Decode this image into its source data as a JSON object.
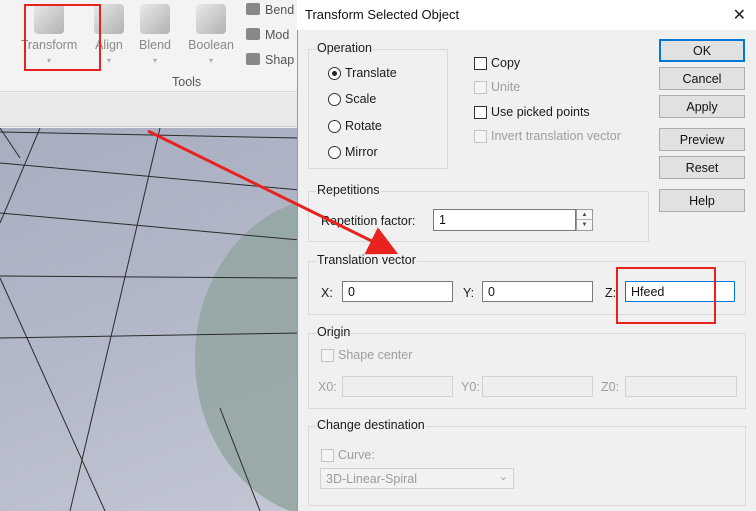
{
  "ribbon": {
    "tools": [
      {
        "label": "Transform",
        "icon": "transform-icon"
      },
      {
        "label": "Align",
        "icon": "align-icon"
      },
      {
        "label": "Blend",
        "icon": "blend-icon"
      },
      {
        "label": "Boolean",
        "icon": "boolean-icon"
      }
    ],
    "side_tools": [
      "Bend",
      "Mod",
      "Shap"
    ],
    "group_label": "Tools"
  },
  "dialog": {
    "title": "Transform Selected Object",
    "close_glyph": "✕",
    "operation": {
      "title": "Operation",
      "options": [
        "Translate",
        "Scale",
        "Rotate",
        "Mirror"
      ],
      "selected": "Translate"
    },
    "options": {
      "copy": "Copy",
      "unite": "Unite",
      "use_picked": "Use picked points",
      "invert": "Invert translation vector"
    },
    "repetitions": {
      "title": "Repetitions",
      "factor_label": "Repetition factor:",
      "factor_value": "1"
    },
    "translation": {
      "title": "Translation vector",
      "x_label": "X:",
      "x_value": "0",
      "y_label": "Y:",
      "y_value": "0",
      "z_label": "Z:",
      "z_value": "Hfeed"
    },
    "origin": {
      "title": "Origin",
      "shape_center": "Shape center",
      "x0": "X0:",
      "y0": "Y0:",
      "z0": "Z0:"
    },
    "destination": {
      "title": "Change destination",
      "curve_label": "Curve:",
      "curve_value": "3D-Linear-Spiral"
    },
    "buttons": {
      "ok": "OK",
      "cancel": "Cancel",
      "apply": "Apply",
      "preview": "Preview",
      "reset": "Reset",
      "help": "Help"
    }
  },
  "colors": {
    "highlight": "#e8231f",
    "accent": "#0078d7",
    "viewport": "#b0b6c6"
  }
}
